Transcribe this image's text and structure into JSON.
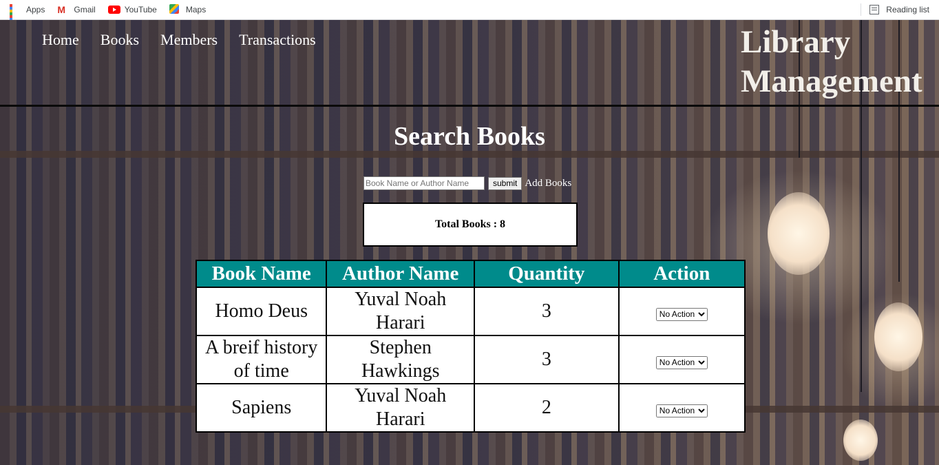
{
  "bookmarks": [
    {
      "label": "Apps",
      "icon": "apps-icon"
    },
    {
      "label": "Gmail",
      "icon": "gmail-icon"
    },
    {
      "label": "YouTube",
      "icon": "youtube-icon"
    },
    {
      "label": "Maps",
      "icon": "maps-icon"
    }
  ],
  "reading_list": {
    "label": "Reading list",
    "icon": "reading-list-icon"
  },
  "nav": {
    "items": [
      "Home",
      "Books",
      "Members",
      "Transactions"
    ]
  },
  "brand": {
    "line1": "Library",
    "line2": "Management"
  },
  "page_title": "Search Books",
  "search": {
    "placeholder": "Book Name or Author Name",
    "value": "",
    "submit_label": "submit",
    "add_label": "Add Books"
  },
  "total": {
    "label": "Total Books : 8"
  },
  "table": {
    "headers": [
      "Book Name",
      "Author Name",
      "Quantity",
      "Action"
    ],
    "rows": [
      {
        "book": "Homo Deus",
        "author": "Yuval Noah Harari",
        "quantity": "3",
        "action": "No Action"
      },
      {
        "book": "A breif history of time",
        "author": "Stephen Hawkings",
        "quantity": "3",
        "action": "No Action"
      },
      {
        "book": "Sapiens",
        "author": "Yuval Noah Harari",
        "quantity": "2",
        "action": "No Action"
      }
    ]
  },
  "colors": {
    "table_header": "#008b8b",
    "header_rule": "#0a0a0a",
    "text_light": "#ffffff"
  }
}
